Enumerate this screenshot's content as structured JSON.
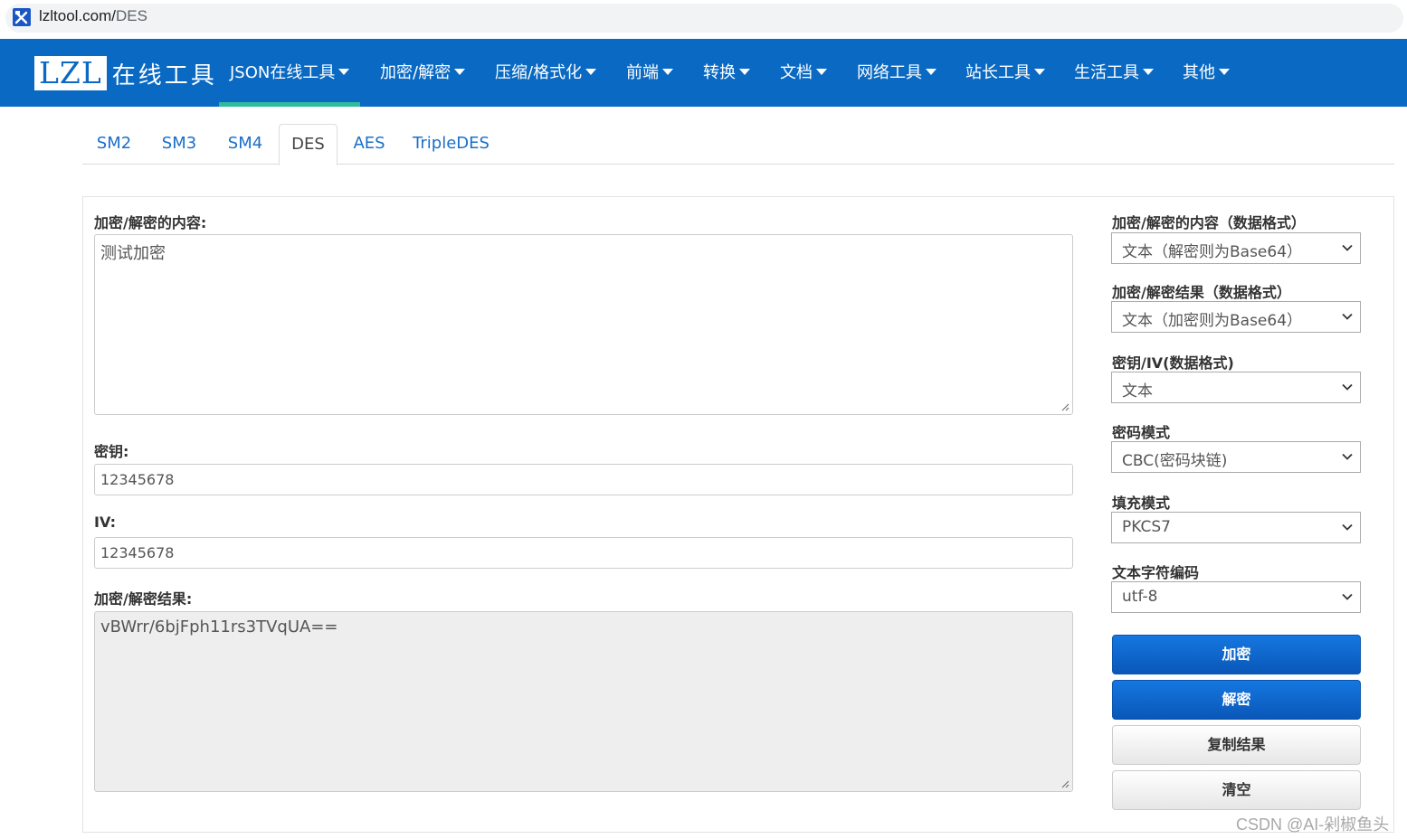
{
  "browser": {
    "url_host": "lzltool.com/",
    "url_path": "DES"
  },
  "brand": {
    "logo": "LZL",
    "name": "在线工具"
  },
  "nav": [
    {
      "label": "JSON在线工具"
    },
    {
      "label": "加密/解密"
    },
    {
      "label": "压缩/格式化"
    },
    {
      "label": "前端"
    },
    {
      "label": "转换"
    },
    {
      "label": "文档"
    },
    {
      "label": "网络工具"
    },
    {
      "label": "站长工具"
    },
    {
      "label": "生活工具"
    },
    {
      "label": "其他"
    }
  ],
  "tabs": [
    {
      "label": "SM2"
    },
    {
      "label": "SM3"
    },
    {
      "label": "SM4"
    },
    {
      "label": "DES",
      "active": true
    },
    {
      "label": "AES"
    },
    {
      "label": "TripleDES"
    }
  ],
  "form": {
    "content_label": "加密/解密的内容:",
    "content_value": "测试加密",
    "key_label": "密钥:",
    "key_value": "12345678",
    "iv_label": "IV:",
    "iv_value": "12345678",
    "result_label": "加密/解密结果:",
    "result_value": "vBWrr/6bjFph11rs3TVqUA=="
  },
  "options": {
    "content_format_label": "加密/解密的内容（数据格式）",
    "content_format_value": "文本（解密则为Base64）",
    "result_format_label": "加密/解密结果（数据格式）",
    "result_format_value": "文本（加密则为Base64）",
    "keyiv_format_label": "密钥/IV(数据格式)",
    "keyiv_format_value": "文本",
    "cipher_mode_label": "密码模式",
    "cipher_mode_value": "CBC(密码块链)",
    "padding_label": "填充模式",
    "padding_value": "PKCS7",
    "charset_label": "文本字符编码",
    "charset_value": "utf-8"
  },
  "buttons": {
    "encrypt": "加密",
    "decrypt": "解密",
    "copy": "复制结果",
    "clear": "清空"
  },
  "watermark": "CSDN @AI-剁椒鱼头",
  "colors": {
    "navbar": "#0969c3",
    "active_underline": "#2fbc9b",
    "tab_link": "#1a6fc9",
    "primary_button": "#0a57b8"
  }
}
